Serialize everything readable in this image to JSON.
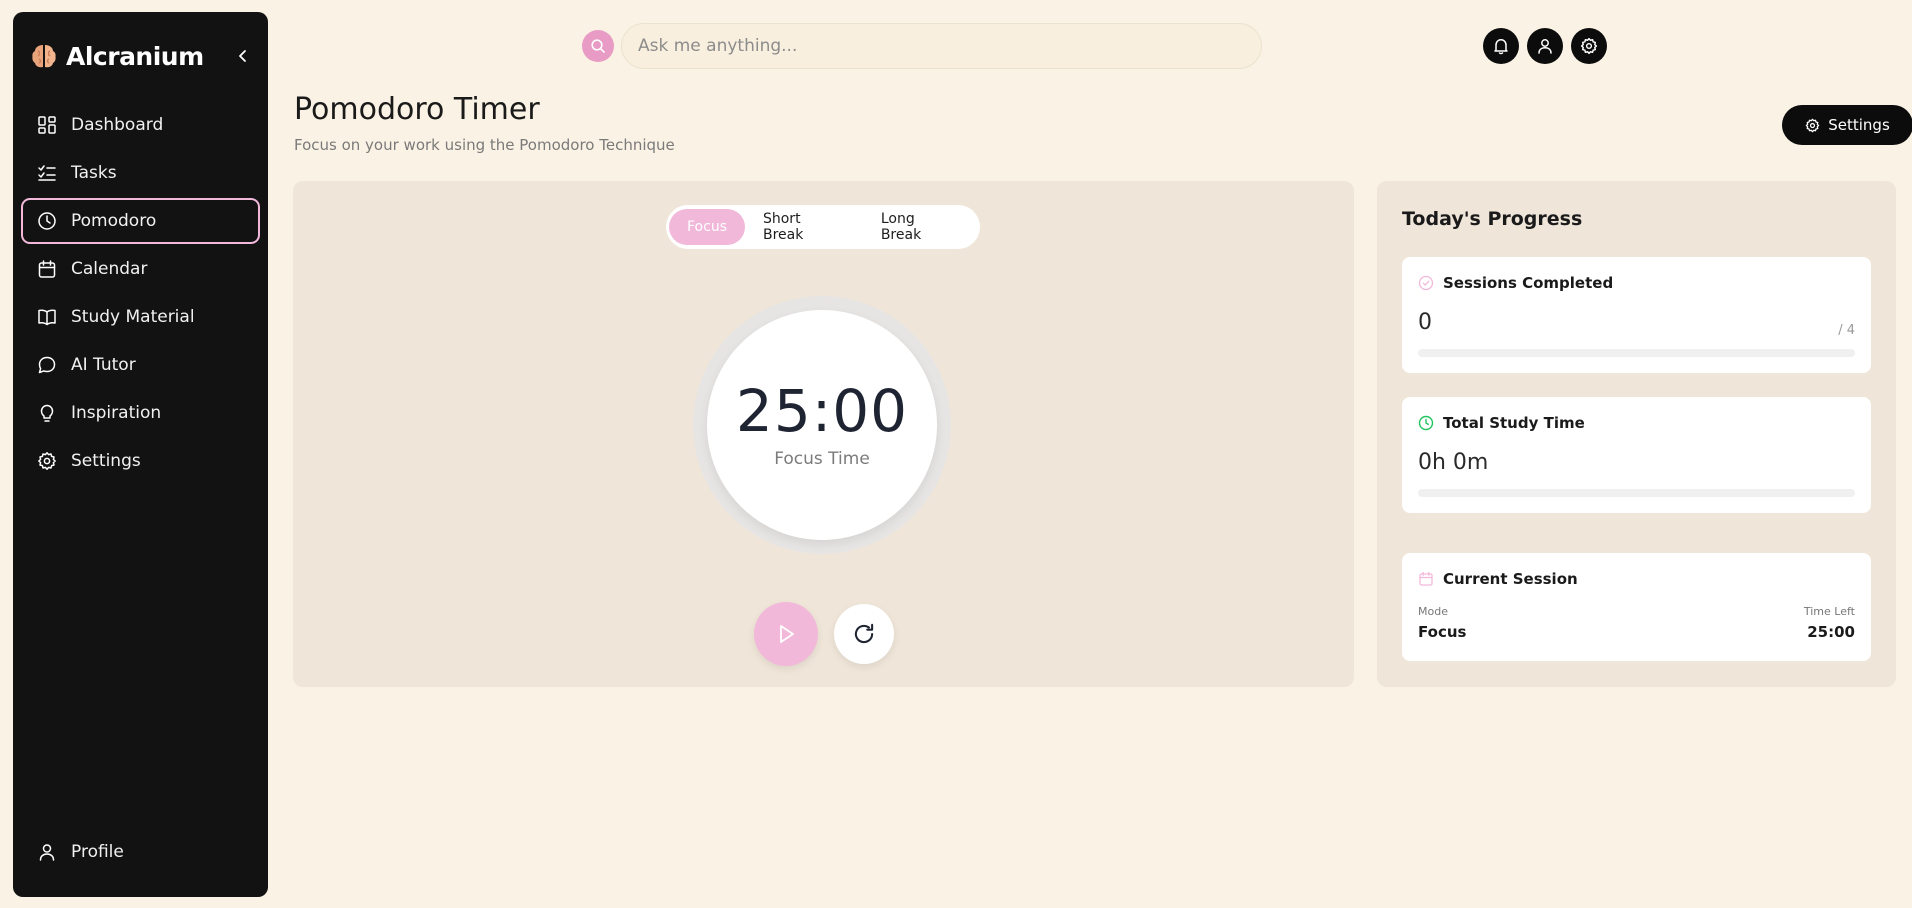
{
  "app": {
    "name": "Alcranium"
  },
  "colors": {
    "accent_pink": "#f2b8da",
    "sidebar_bg": "#121212",
    "page_bg": "#faf2e4",
    "success_green": "#22c55e"
  },
  "sidebar": {
    "items": [
      {
        "label": "Dashboard",
        "icon": "dashboard-icon"
      },
      {
        "label": "Tasks",
        "icon": "list-check-icon"
      },
      {
        "label": "Pomodoro",
        "icon": "clock-icon",
        "active": true
      },
      {
        "label": "Calendar",
        "icon": "calendar-icon"
      },
      {
        "label": "Study Material",
        "icon": "book-icon"
      },
      {
        "label": "AI Tutor",
        "icon": "chat-bubble-icon"
      },
      {
        "label": "Inspiration",
        "icon": "lightbulb-icon"
      },
      {
        "label": "Settings",
        "icon": "gear-icon"
      }
    ],
    "profile": {
      "label": "Profile",
      "icon": "user-icon"
    }
  },
  "search": {
    "placeholder": "Ask me anything..."
  },
  "header": {
    "title": "Pomodoro Timer",
    "subtitle": "Focus on your work using the Pomodoro Technique",
    "settings_label": "Settings"
  },
  "timer": {
    "tabs": [
      {
        "label": "Focus",
        "active": true
      },
      {
        "label": "Short Break"
      },
      {
        "label": "Long Break"
      }
    ],
    "time": "25:00",
    "caption": "Focus Time"
  },
  "progress": {
    "title": "Today's Progress",
    "sessions": {
      "label": "Sessions Completed",
      "value": "0",
      "suffix": "/ 4",
      "fraction": 0
    },
    "study_time": {
      "label": "Total Study Time",
      "value": "0h 0m",
      "fraction": 0
    },
    "current": {
      "label": "Current Session",
      "mode_label": "Mode",
      "mode_value": "Focus",
      "time_left_label": "Time Left",
      "time_left_value": "25:00"
    }
  }
}
